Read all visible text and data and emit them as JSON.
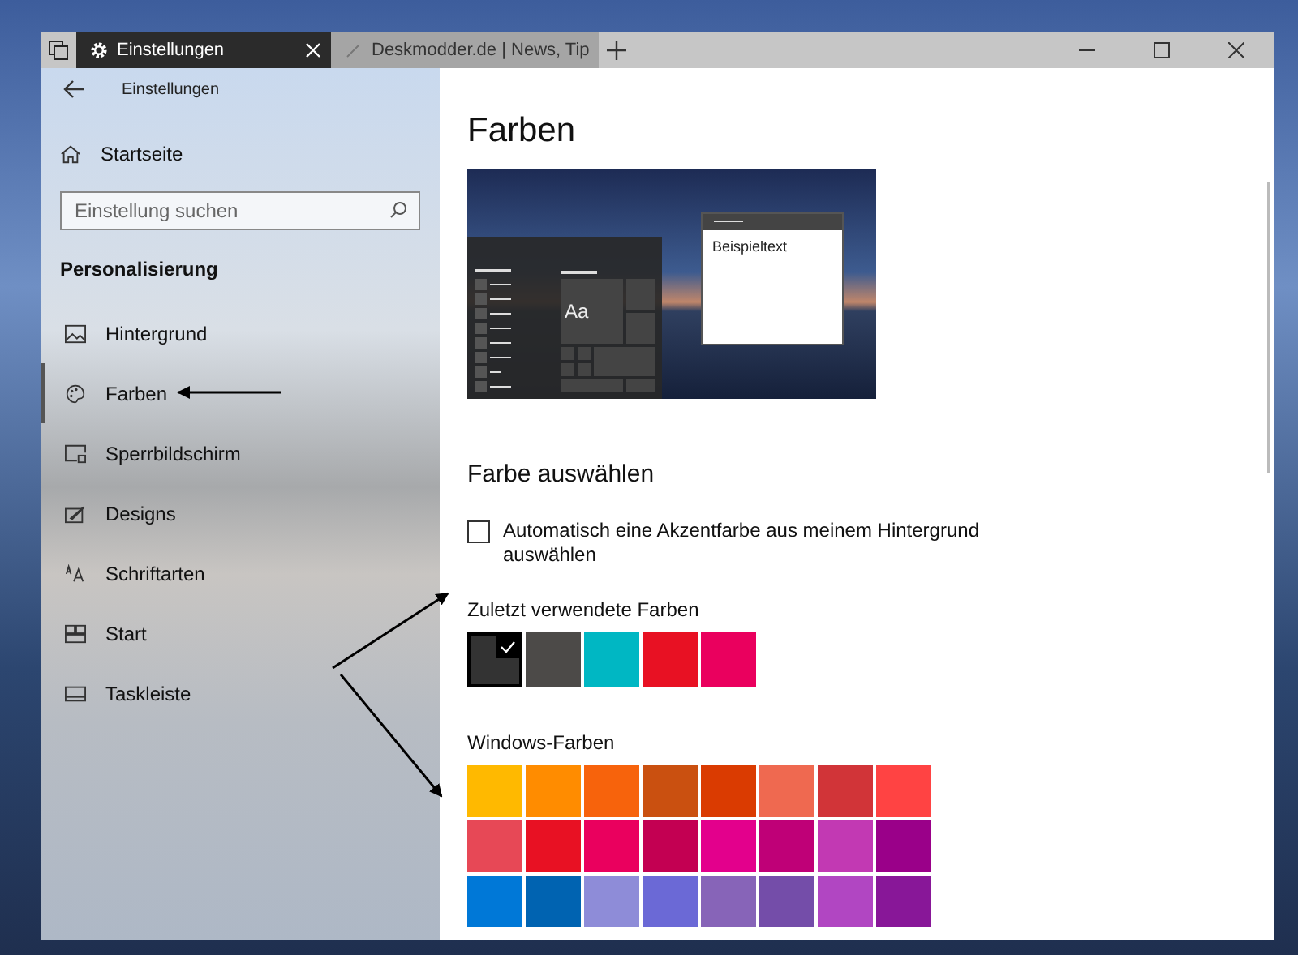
{
  "browser": {
    "tabs": [
      {
        "title": "Einstellungen",
        "kind": "settings",
        "selected": true
      },
      {
        "title": "Deskmodder.de | News, Tip",
        "kind": "web",
        "selected": false
      }
    ]
  },
  "sidebar": {
    "back_title": "Einstellungen",
    "home": "Startseite",
    "search": {
      "placeholder": "Einstellung suchen"
    },
    "section": "Personalisierung",
    "items": [
      {
        "label": "Hintergrund",
        "kind": "picture",
        "selected": false
      },
      {
        "label": "Farben",
        "kind": "palette",
        "selected": true
      },
      {
        "label": "Sperrbildschirm",
        "kind": "lockscreen",
        "selected": false
      },
      {
        "label": "Designs",
        "kind": "designs",
        "selected": false
      },
      {
        "label": "Schriftarten",
        "kind": "fonts",
        "selected": false
      },
      {
        "label": "Start",
        "kind": "start",
        "selected": false
      },
      {
        "label": "Taskleiste",
        "kind": "taskbar",
        "selected": false
      }
    ]
  },
  "content": {
    "title": "Farben",
    "preview": {
      "tile_text": "Aa",
      "sample_text": "Beispieltext"
    },
    "section_title": "Farbe auswählen",
    "auto_accent": {
      "label": "Automatisch eine Akzentfarbe aus meinem Hintergrund auswählen",
      "checked": false
    },
    "recent": {
      "label": "Zuletzt verwendete Farben",
      "swatches": [
        {
          "color": "#333333",
          "selected": true
        },
        {
          "color": "#4c4a48",
          "selected": false
        },
        {
          "color": "#00b7c3",
          "selected": false
        },
        {
          "color": "#e81123",
          "selected": false
        },
        {
          "color": "#ea005e",
          "selected": false
        }
      ]
    },
    "windows_colors": {
      "label": "Windows-Farben",
      "swatches": [
        {
          "color": "#ffb900",
          "selected": false
        },
        {
          "color": "#ff8c00",
          "selected": false
        },
        {
          "color": "#f7630c",
          "selected": false
        },
        {
          "color": "#ca5010",
          "selected": false
        },
        {
          "color": "#da3b01",
          "selected": false
        },
        {
          "color": "#ef6950",
          "selected": false
        },
        {
          "color": "#d13438",
          "selected": false
        },
        {
          "color": "#ff4343",
          "selected": false
        },
        {
          "color": "#e74856",
          "selected": false
        },
        {
          "color": "#e81123",
          "selected": false
        },
        {
          "color": "#ea005e",
          "selected": false
        },
        {
          "color": "#c30052",
          "selected": false
        },
        {
          "color": "#e3008c",
          "selected": false
        },
        {
          "color": "#bf0077",
          "selected": false
        },
        {
          "color": "#c239b3",
          "selected": false
        },
        {
          "color": "#9a0089",
          "selected": false
        },
        {
          "color": "#0078d7",
          "selected": false
        },
        {
          "color": "#0063b1",
          "selected": false
        },
        {
          "color": "#8e8cd8",
          "selected": false
        },
        {
          "color": "#6b69d6",
          "selected": false
        },
        {
          "color": "#8764b8",
          "selected": false
        },
        {
          "color": "#744da9",
          "selected": false
        },
        {
          "color": "#b146c2",
          "selected": false
        },
        {
          "color": "#881798",
          "selected": false
        }
      ]
    }
  }
}
